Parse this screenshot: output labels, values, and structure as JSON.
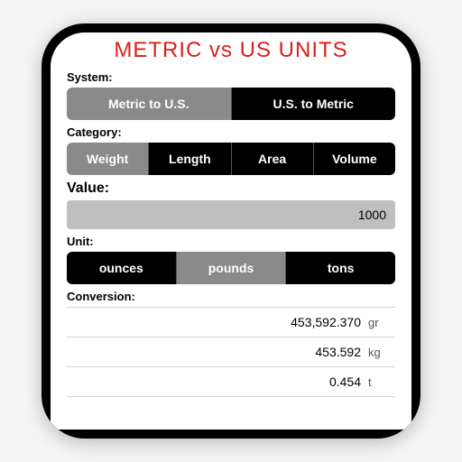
{
  "title": "METRIC vs US UNITS",
  "labels": {
    "system": "System:",
    "category": "Category:",
    "value": "Value:",
    "unit": "Unit:",
    "conversion": "Conversion:"
  },
  "system": {
    "options": [
      "Metric to U.S.",
      "U.S. to Metric"
    ],
    "selected": 0
  },
  "category": {
    "options": [
      "Weight",
      "Length",
      "Area",
      "Volume"
    ],
    "selected": 0
  },
  "value": "1000",
  "unit": {
    "options": [
      "ounces",
      "pounds",
      "tons"
    ],
    "selected": 1
  },
  "conversions": [
    {
      "value": "453,592.370",
      "unit": "gr"
    },
    {
      "value": "453.592",
      "unit": "kg"
    },
    {
      "value": "0.454",
      "unit": "t"
    }
  ]
}
